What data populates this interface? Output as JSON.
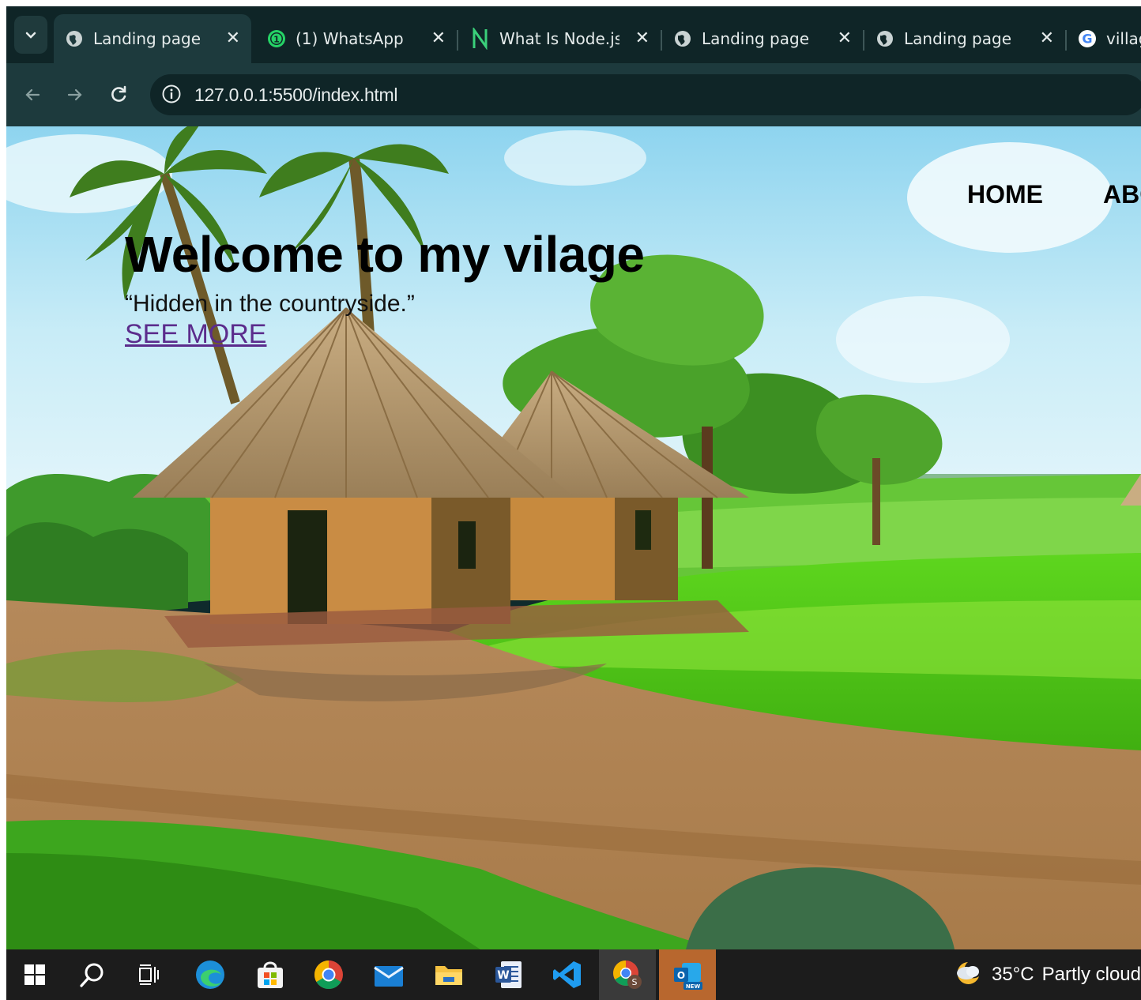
{
  "browser": {
    "tabs": [
      {
        "title": "Landing page",
        "favicon": "globe-icon",
        "active": true
      },
      {
        "title": "(1) WhatsApp",
        "favicon": "whatsapp-icon",
        "active": false
      },
      {
        "title": "What Is Node.js? C",
        "favicon": "node-icon",
        "active": false
      },
      {
        "title": "Landing page",
        "favicon": "globe-icon",
        "active": false
      },
      {
        "title": "Landing page",
        "favicon": "globe-icon",
        "active": false
      },
      {
        "title": "village",
        "favicon": "google-icon",
        "active": false
      }
    ],
    "url": "127.0.0.1:5500/index.html"
  },
  "page": {
    "nav": [
      "HOME",
      "ABC"
    ],
    "hero_title": "Welcome to my vilage",
    "hero_subtitle": "“Hidden in the countryside.”",
    "cta": "SEE MORE",
    "link_color": "#5b2c8c"
  },
  "taskbar": {
    "apps": [
      "windows-start-icon",
      "search-icon",
      "task-view-icon",
      "edge-icon",
      "microsoft-store-icon",
      "chrome-icon",
      "mail-icon",
      "file-explorer-icon",
      "word-icon",
      "vscode-icon",
      "chrome-profile-icon",
      "outlook-new-icon"
    ],
    "weather": {
      "temp": "35°C",
      "condition": "Partly cloud"
    }
  }
}
